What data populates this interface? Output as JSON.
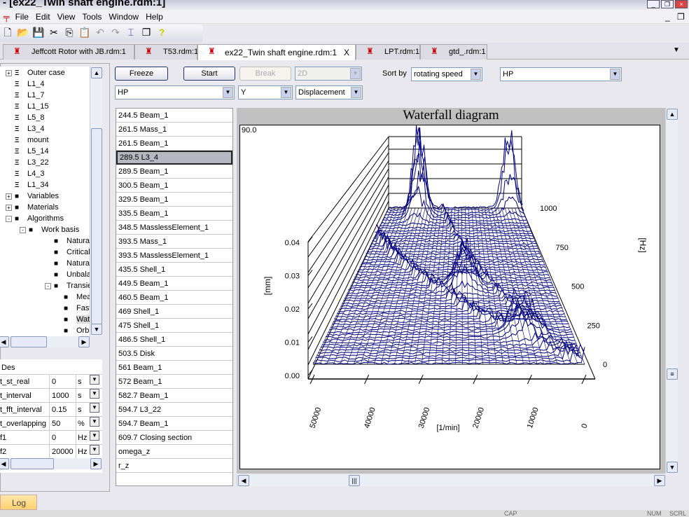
{
  "window": {
    "title": "- [ex22_Twin shaft engine.rdm:1]"
  },
  "menu": [
    "File",
    "Edit",
    "View",
    "Tools",
    "Window",
    "Help"
  ],
  "toolbar": [
    "new-icon",
    "open-icon",
    "save-icon",
    "cut-icon",
    "copy-icon",
    "paste-icon",
    "undo-icon",
    "redo-icon",
    "model-icon",
    "windows-icon",
    "help-icon"
  ],
  "tabs": [
    {
      "label": "Jeffcott Rotor with JB.rdm:1"
    },
    {
      "label": "T53.rdm:1"
    },
    {
      "label": "ex22_Twin shaft engine.rdm:1",
      "active": true,
      "close": "X"
    },
    {
      "label": "LPT.rdm:1"
    },
    {
      "label": "gtd_.rdm:1"
    }
  ],
  "tree": [
    {
      "label": "Outer case",
      "level": 0,
      "expander": "+"
    },
    {
      "label": "L1_4",
      "level": 0
    },
    {
      "label": "L1_7",
      "level": 0
    },
    {
      "label": "L1_15",
      "level": 0
    },
    {
      "label": "L5_8",
      "level": 0
    },
    {
      "label": "L3_4",
      "level": 0
    },
    {
      "label": "mount",
      "level": 0
    },
    {
      "label": "L5_14",
      "level": 0
    },
    {
      "label": "L3_22",
      "level": 0
    },
    {
      "label": "L4_3",
      "level": 0
    },
    {
      "label": "L1_34",
      "level": 0
    },
    {
      "label": "Variables",
      "level": 0,
      "expander": "+"
    },
    {
      "label": "Materials",
      "level": 0,
      "expander": "+"
    },
    {
      "label": "Algorithms",
      "level": 0,
      "expander": "-"
    },
    {
      "label": "Work basis",
      "level": 1,
      "expander": "-"
    },
    {
      "label": "Natural fr",
      "level": 2
    },
    {
      "label": "Critical Sp",
      "level": 2
    },
    {
      "label": "Natural fr",
      "level": 2
    },
    {
      "label": "Unbalanc",
      "level": 2
    },
    {
      "label": "Transient",
      "level": 2,
      "expander": "-"
    },
    {
      "label": "Mea",
      "level": 3
    },
    {
      "label": "Fast",
      "level": 3
    },
    {
      "label": "Wate",
      "level": 3,
      "selected": true
    },
    {
      "label": "Orbit",
      "level": 3
    }
  ],
  "properties": {
    "header": "Des",
    "rows": [
      {
        "name": "t_st_real",
        "value": "0",
        "unit": "s"
      },
      {
        "name": "t_interval",
        "value": "1000",
        "unit": "s"
      },
      {
        "name": "t_fft_interval",
        "value": "0.15",
        "unit": "s"
      },
      {
        "name": "t_overlapping",
        "value": "50",
        "unit": "%"
      },
      {
        "name": "f1",
        "value": "0",
        "unit": "Hz"
      },
      {
        "name": "f2",
        "value": "20000",
        "unit": "Hz"
      }
    ]
  },
  "controls": {
    "freeze": "Freeze",
    "start": "Start",
    "break": "Break",
    "mode": "2D",
    "sort_by_label": "Sort by",
    "sort_by": "rotating speed",
    "rotor": "HP",
    "rotor2": "HP",
    "direction": "Y",
    "quantity": "Displacement"
  },
  "nodes": [
    "244.5 Beam_1",
    "261.5 Mass_1",
    "261.5 Beam_1",
    "289.5 L3_4",
    "289.5 Beam_1",
    "300.5 Beam_1",
    "329.5 Beam_1",
    "335.5 Beam_1",
    "348.5 MasslessElement_1",
    "393.5 Mass_1",
    "393.5 MasslessElement_1",
    "435.5 Shell_1",
    "449.5 Beam_1",
    "460.5 Beam_1",
    "469 Shell_1",
    "475 Shell_1",
    "486.5 Shell_1",
    "503.5 Disk",
    "561 Beam_1",
    "572 Beam_1",
    "582.7 Beam_1",
    "594.7 L3_22",
    "594.7 Beam_1",
    "609.7 Closing section",
    "omega_z",
    "r_z"
  ],
  "selected_node": "289.5 L3_4",
  "log_tab": "Log",
  "status": {
    "caps": "CAP",
    "num": "NUM",
    "scrl": "SCRL"
  },
  "chart_data": {
    "type": "waterfall",
    "title": "Waterfall diagram",
    "corner_label": "90.0",
    "zlabel": "[mm]",
    "zticks": [
      "0.00",
      "0.01",
      "0.02",
      "0.03",
      "0.04"
    ],
    "zlim": [
      0,
      0.045
    ],
    "xlabel": "[1/min]",
    "xticks": [
      "50000",
      "40000",
      "30000",
      "20000",
      "10000",
      "0"
    ],
    "xlim": [
      0,
      50000
    ],
    "ylabel": "[Hz]",
    "yticks": [
      "0",
      "250",
      "500",
      "750",
      "1000"
    ],
    "ylim": [
      0,
      1000
    ],
    "series_color": "#00007f",
    "peaks": [
      {
        "rpm": 38000,
        "hz": 960,
        "mm": 0.045
      },
      {
        "rpm": 5000,
        "hz": 1000,
        "mm": 0.04
      },
      {
        "rpm": 22000,
        "hz": 500,
        "mm": 0.02
      },
      {
        "rpm": 10000,
        "hz": 200,
        "mm": 0.018
      }
    ]
  }
}
